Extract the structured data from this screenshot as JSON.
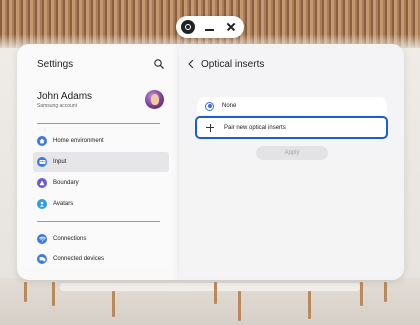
{
  "window": {
    "controls": {
      "app_icon": "app-icon",
      "minimize_icon": "minimize-icon",
      "close_icon": "close-icon"
    }
  },
  "sidebar": {
    "title": "Settings",
    "search_icon": "search-icon",
    "profile": {
      "name": "John Adams",
      "subtitle": "Samsung account",
      "avatar": "avatar"
    },
    "items": [
      {
        "label": "Home environment",
        "icon": "home-icon",
        "color": "#3d7be0",
        "selected": false
      },
      {
        "label": "Input",
        "icon": "input-icon",
        "color": "#3d7be0",
        "selected": true
      },
      {
        "label": "Boundary",
        "icon": "boundary-icon",
        "color": "#6a5acd",
        "selected": false
      },
      {
        "label": "Avatars",
        "icon": "avatar-icon",
        "color": "#2f9be0",
        "selected": false
      }
    ],
    "items2": [
      {
        "label": "Connections",
        "icon": "wifi-icon",
        "color": "#3d7be0",
        "selected": false
      },
      {
        "label": "Connected devices",
        "icon": "devices-icon",
        "color": "#3d7be0",
        "selected": false
      }
    ]
  },
  "main": {
    "back_icon": "chevron-left-icon",
    "title": "Optical inserts",
    "options": [
      {
        "label": "None",
        "selected": true
      },
      {
        "label": "Pair new optical inserts",
        "icon": "plus-icon",
        "focused": true
      }
    ],
    "apply_label": "Apply",
    "accent": "#3c6ee0",
    "focus_color": "#1c5fc7"
  }
}
